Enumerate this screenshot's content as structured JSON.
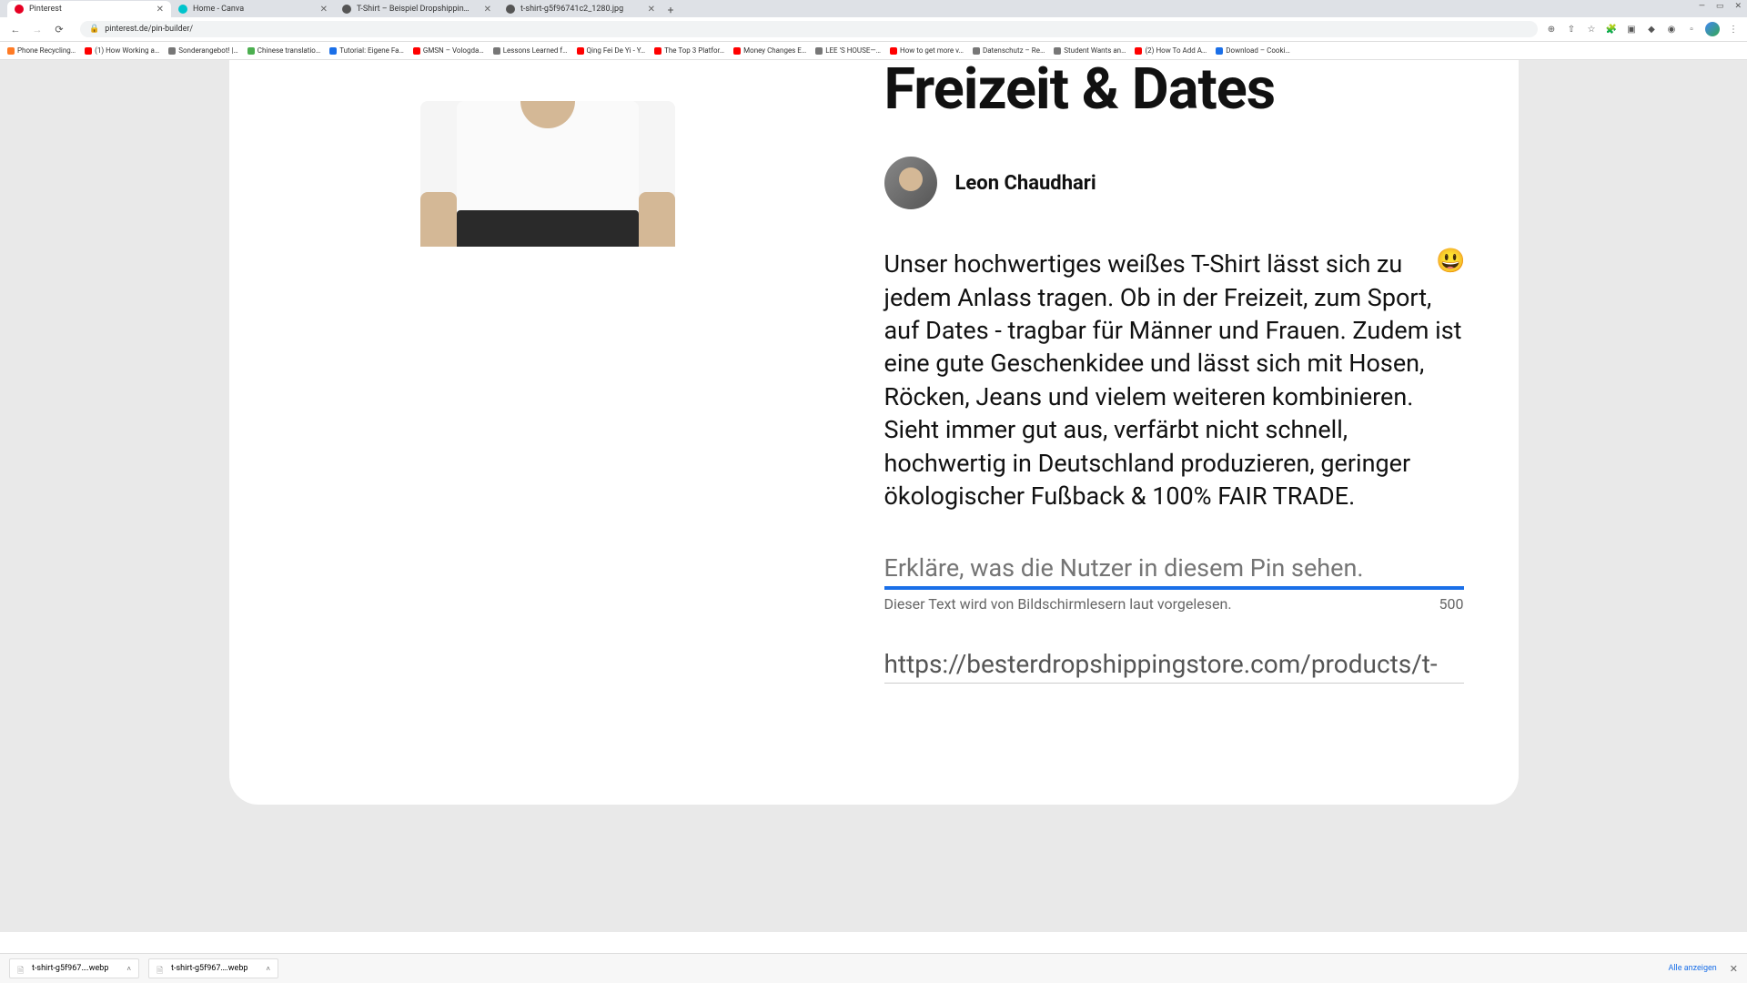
{
  "browser": {
    "tabs": [
      {
        "title": "Pinterest",
        "favicon": "#e60023",
        "active": true
      },
      {
        "title": "Home - Canva",
        "favicon": "#00c4cc",
        "active": false
      },
      {
        "title": "T-Shirt – Beispiel Dropshippin…",
        "favicon": "#555",
        "active": false
      },
      {
        "title": "t-shirt-g5f96741c2_1280.jpg",
        "favicon": "#555",
        "active": false
      }
    ],
    "url": "pinterest.de/pin-builder/",
    "bookmarks": [
      {
        "label": "Phone Recycling…",
        "color": "#ff7b25"
      },
      {
        "label": "(1) How Working a…",
        "color": "#ff0000"
      },
      {
        "label": "Sonderangebot! |…",
        "color": "#777"
      },
      {
        "label": "Chinese translatio…",
        "color": "#4caf50"
      },
      {
        "label": "Tutorial: Eigene Fa…",
        "color": "#1a6fe8"
      },
      {
        "label": "GMSN – Vologda…",
        "color": "#ff0000"
      },
      {
        "label": "Lessons Learned f…",
        "color": "#777"
      },
      {
        "label": "Qing Fei De Yi - Y…",
        "color": "#ff0000"
      },
      {
        "label": "The Top 3 Platfor…",
        "color": "#ff0000"
      },
      {
        "label": "Money Changes E…",
        "color": "#ff0000"
      },
      {
        "label": "LEE 'S HOUSE—…",
        "color": "#777"
      },
      {
        "label": "How to get more v…",
        "color": "#ff0000"
      },
      {
        "label": "Datenschutz – Re…",
        "color": "#777"
      },
      {
        "label": "Student Wants an…",
        "color": "#777"
      },
      {
        "label": "(2) How To Add A…",
        "color": "#ff0000"
      },
      {
        "label": "Download – Cooki…",
        "color": "#1a6fe8"
      }
    ]
  },
  "pin": {
    "headline": "Freizeit & Dates",
    "author": "Leon Chaudhari",
    "description": "Unser hochwertiges weißes T-Shirt lässt sich zu jedem Anlass tragen. Ob in der Freizeit, zum Sport, auf Dates - tragbar für Männer und Frauen. Zudem ist eine gute Geschenkidee und lässt sich mit Hosen, Röcken, Jeans und vielem weiteren kombinieren. Sieht immer gut aus, verfärbt nicht schnell, hochwertig in Deutschland produzieren, geringer ökologischer Fußback & 100% FAIR TRADE.",
    "emoji": "😃",
    "alt_placeholder": "Erkläre, was die Nutzer in diesem Pin sehen.",
    "alt_helper": "Dieser Text wird von Bildschirmlesern laut vorgelesen.",
    "alt_counter": "500",
    "link_value": "https://besterdropshippingstore.com/products/t-"
  },
  "downloads": {
    "items": [
      {
        "name": "t-shirt-g5f967….webp"
      },
      {
        "name": "t-shirt-g5f967….webp"
      }
    ],
    "show_all": "Alle anzeigen"
  }
}
